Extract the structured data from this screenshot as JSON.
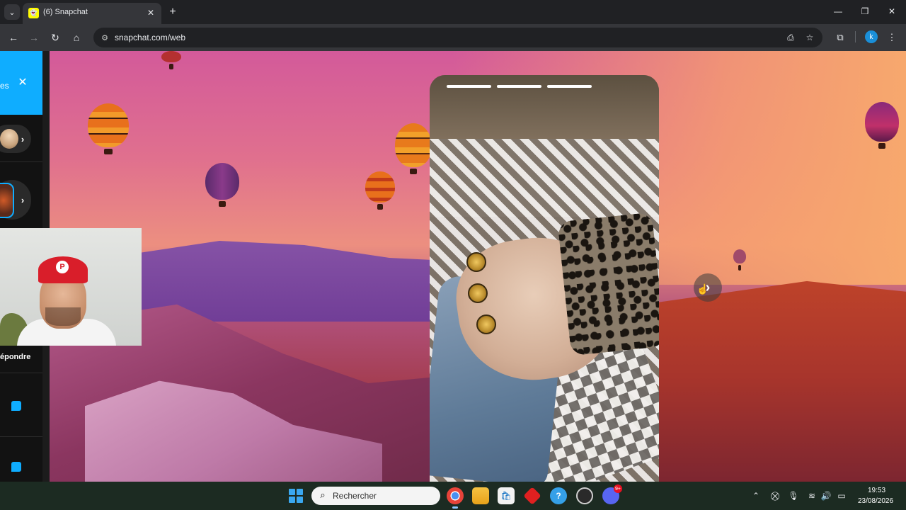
{
  "browser": {
    "tab_title": "(6) Snapchat",
    "tab_close": "✕",
    "new_tab": "+",
    "url": "snapchat.com/web",
    "profile_initial": "k",
    "window_minimize": "—",
    "window_restore": "❐",
    "window_close": "✕"
  },
  "snapchat": {
    "promo_text": "es",
    "promo_close": "✕",
    "reply_label": "épondre",
    "story_chevron": "›",
    "next_arrow": "›"
  },
  "story": {
    "progress_segments": 3
  },
  "taskbar": {
    "search_placeholder": "Rechercher",
    "discord_badge": "9+",
    "time": "19:53",
    "date": "23/08/2026"
  },
  "colors": {
    "snap_blue": "#0fadff",
    "snap_yellow": "#fffc00",
    "chrome_dark": "#202124",
    "taskbar": "#1c2b22"
  },
  "icons": [
    "tab-menu-icon",
    "snapchat-favicon",
    "back-icon",
    "forward-icon",
    "reload-icon",
    "home-icon",
    "site-info-icon",
    "install-icon",
    "bookmark-star-icon",
    "extensions-icon",
    "menu-kebab-icon",
    "close-icon",
    "chevron-right-icon",
    "chat-icon",
    "windows-start-icon",
    "search-icon",
    "chrome-icon",
    "file-explorer-icon",
    "store-icon",
    "gem-app-icon",
    "help-icon",
    "obs-icon",
    "discord-icon",
    "chevron-up-icon",
    "network-icon",
    "microphone-icon",
    "wifi-icon",
    "volume-icon",
    "battery-icon"
  ]
}
